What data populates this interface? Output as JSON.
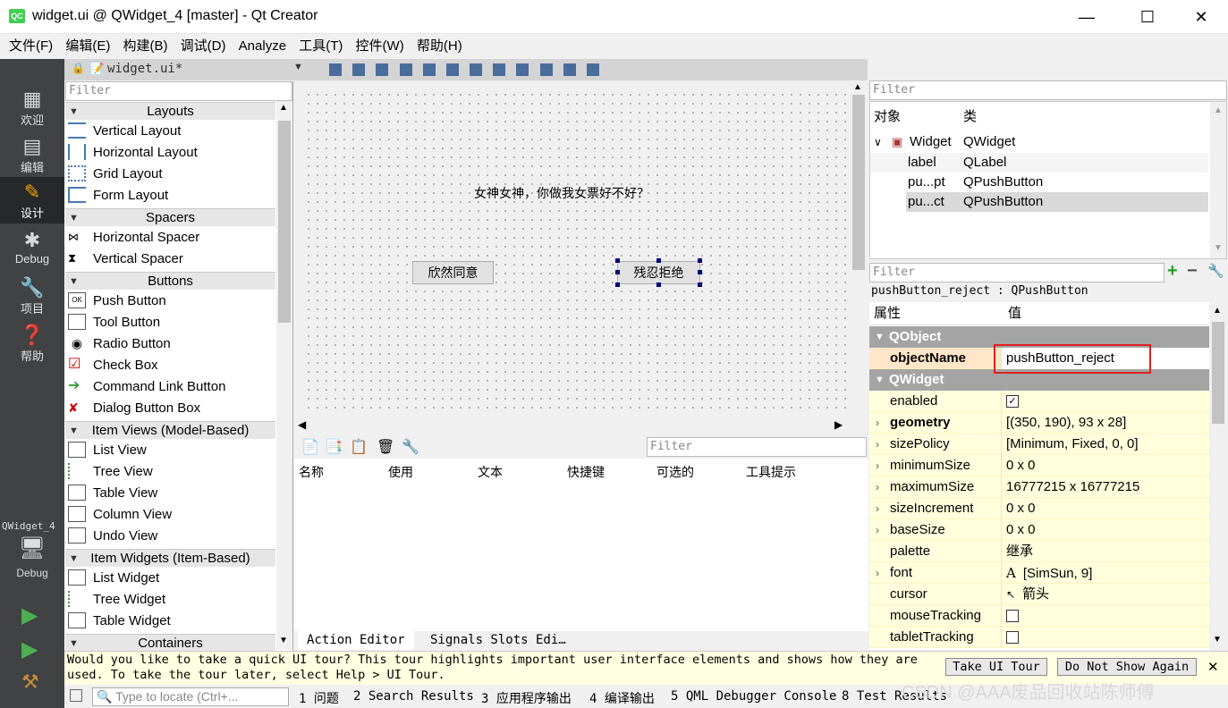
{
  "window": {
    "title": "widget.ui @ QWidget_4 [master] - Qt Creator",
    "app_icon": "QC",
    "min_glyph": "—",
    "max_glyph": "☐",
    "close_glyph": "✕"
  },
  "menu": [
    "文件(F)",
    "编辑(E)",
    "构建(B)",
    "调试(D)",
    "Analyze",
    "工具(T)",
    "控件(W)",
    "帮助(H)"
  ],
  "modes": {
    "welcome": "欢迎",
    "edit": "编辑",
    "design": "设计",
    "debug": "Debug",
    "projects": "项目",
    "help": "帮助",
    "kit_project": "QWidget_4",
    "kit_build": "Debug"
  },
  "document_tab": {
    "name": "widget.ui*"
  },
  "widget_box": {
    "filter_placeholder": "Filter",
    "categories": {
      "layouts": "Layouts",
      "spacers": "Spacers",
      "buttons": "Buttons",
      "item_views": "Item Views (Model-Based)",
      "item_widgets": "Item Widgets (Item-Based)",
      "containers": "Containers"
    },
    "items": {
      "vertical_layout": "Vertical Layout",
      "horizontal_layout": "Horizontal Layout",
      "grid_layout": "Grid Layout",
      "form_layout": "Form Layout",
      "horizontal_spacer": "Horizontal Spacer",
      "vertical_spacer": "Vertical Spacer",
      "push_button": "Push Button",
      "tool_button": "Tool Button",
      "radio_button": "Radio Button",
      "check_box": "Check Box",
      "command_link_button": "Command Link Button",
      "dialog_button_box": "Dialog Button Box",
      "list_view": "List View",
      "tree_view": "Tree View",
      "table_view": "Table View",
      "column_view": "Column View",
      "undo_view": "Undo View",
      "list_widget": "List Widget",
      "tree_widget": "Tree Widget",
      "table_widget": "Table Widget"
    }
  },
  "form": {
    "label_text": "女神女神，你做我女票好不好？",
    "accept_button": "欣然同意",
    "reject_button": "残忍拒绝"
  },
  "action_editor": {
    "filter_placeholder": "Filter",
    "columns": [
      "名称",
      "使用",
      "文本",
      "快捷键",
      "可选的",
      "工具提示"
    ],
    "tabs": {
      "action_editor": "Action Editor",
      "signals_slots": "Signals  Slots Edi…"
    }
  },
  "object_inspector": {
    "filter_placeholder": "Filter",
    "headers": {
      "object": "对象",
      "class": "类"
    },
    "rows": [
      {
        "name": "Widget",
        "class": "QWidget"
      },
      {
        "name": "label",
        "class": "QLabel"
      },
      {
        "name": "pu...pt",
        "class": "QPushButton"
      },
      {
        "name": "pu...ct",
        "class": "QPushButton"
      }
    ]
  },
  "property_editor": {
    "filter_placeholder": "Filter",
    "object_line": "pushButton_reject : QPushButton",
    "headers": {
      "property": "属性",
      "value": "值"
    },
    "sections": {
      "qobject": "QObject",
      "qwidget": "QWidget"
    },
    "props": {
      "objectName": {
        "name": "objectName",
        "value": "pushButton_reject"
      },
      "enabled": {
        "name": "enabled",
        "value": "✓"
      },
      "geometry": {
        "name": "geometry",
        "value": "[(350, 190), 93 x 28]"
      },
      "sizePolicy": {
        "name": "sizePolicy",
        "value": "[Minimum, Fixed, 0, 0]"
      },
      "minimumSize": {
        "name": "minimumSize",
        "value": "0 x 0"
      },
      "maximumSize": {
        "name": "maximumSize",
        "value": "16777215 x 16777215"
      },
      "sizeIncrement": {
        "name": "sizeIncrement",
        "value": "0 x 0"
      },
      "baseSize": {
        "name": "baseSize",
        "value": "0 x 0"
      },
      "palette": {
        "name": "palette",
        "value": "继承"
      },
      "font": {
        "name": "font",
        "value": "[SimSun, 9]",
        "glyph": "A"
      },
      "cursor": {
        "name": "cursor",
        "value": "箭头"
      },
      "mouseTracking": {
        "name": "mouseTracking",
        "value": ""
      },
      "tabletTracking": {
        "name": "tabletTracking",
        "value": ""
      }
    }
  },
  "tour": {
    "message_line1": "Would you like to take a quick UI tour? This tour highlights important user interface elements and shows how they are",
    "message_line2": "used. To take the tour later, select Help > UI Tour.",
    "take_tour": "Take UI Tour",
    "dont_show": "Do Not Show Again"
  },
  "statusbar": {
    "locate_placeholder": "Type to locate (Ctrl+...",
    "panes": [
      "1 问题",
      "2 Search Results",
      "3 应用程序输出",
      "4 编译输出",
      "5 QML Debugger Console",
      "8 Test Results"
    ]
  },
  "watermark": "CSDN @AAA废品回收站陈师傅",
  "colors": {
    "accent_highlight": "#e02020",
    "property_row": "#ffffde",
    "section": "#a4a4a4",
    "mode_bar": "#404244"
  }
}
